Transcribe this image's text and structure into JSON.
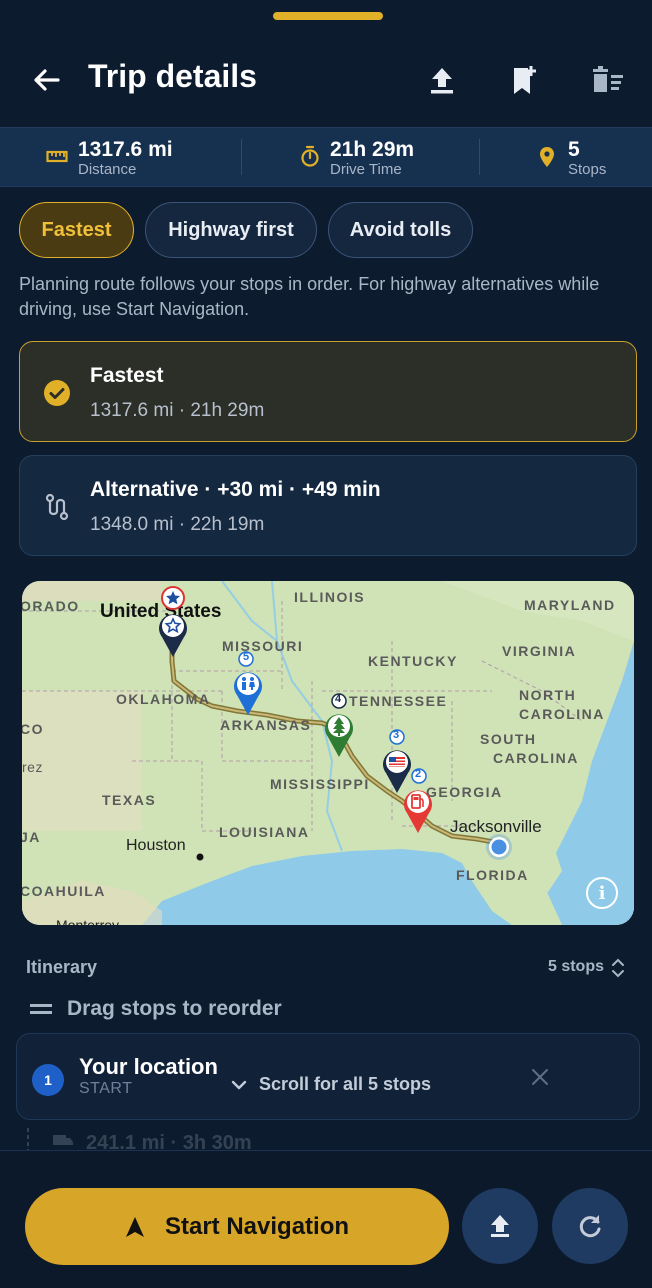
{
  "header": {
    "title": "Trip details"
  },
  "stats": {
    "distance_value": "1317.6 mi",
    "distance_label": "Distance",
    "drive_time_value": "21h 29m",
    "drive_time_label": "Drive Time",
    "stops_value": "5",
    "stops_label": "Stops"
  },
  "route_options": [
    "Fastest",
    "Highway first",
    "Avoid tolls"
  ],
  "route_options_selected": "Fastest",
  "note": "Planning route follows your stops in order. For highway alternatives while driving, use Start Navigation.",
  "routes": [
    {
      "title": "Fastest",
      "subtitle": "1317.6 mi · 21h 29m",
      "selected": true
    },
    {
      "title": "Alternative · +30 mi · +49 min",
      "subtitle": "1348.0 mi · 22h 19m",
      "selected": false
    }
  ],
  "map": {
    "labels": {
      "illinois": "ILLINOIS",
      "maryland": "MARYLAND",
      "missouri": "MISSOURI",
      "kentucky": "KENTUCKY",
      "virginia": "VIRGINIA",
      "oklahoma": "OKLAHOMA",
      "tennessee": "TENNESSEE",
      "north_carolina_1": "NORTH",
      "north_carolina_2": "CAROLINA",
      "arkansas": "ARKANSAS",
      "south_carolina_1": "SOUTH",
      "south_carolina_2": "CAROLINA",
      "mississippi": "MISSISSIPPI",
      "georgia": "GEORGIA",
      "texas": "TEXAS",
      "louisiana": "LOUISIANA",
      "florida": "FLORIDA",
      "coahuila": "COAHUILA",
      "orado": "ORADO",
      "co": "CO",
      "rez": "rez",
      "ja": "JA"
    },
    "cities": {
      "united_states": "United States",
      "houston": "Houston",
      "jacksonville": "Jacksonville",
      "monterrey": "Monterrey"
    },
    "markers": [
      "5",
      "4",
      "3",
      "2"
    ]
  },
  "itinerary": {
    "title": "Itinerary",
    "count": "5 stops",
    "drag_hint": "Drag stops to reorder",
    "first_stop": {
      "number": "1",
      "name": "Your location",
      "type": "START"
    },
    "scroll_hint": "Scroll for all 5 stops",
    "faded_leg": "241.1 mi · 3h 30m"
  },
  "bottom": {
    "start_label": "Start Navigation"
  },
  "colors": {
    "accent": "#d7a528",
    "background": "#0d1b2e",
    "route": "#8a7a3a"
  }
}
